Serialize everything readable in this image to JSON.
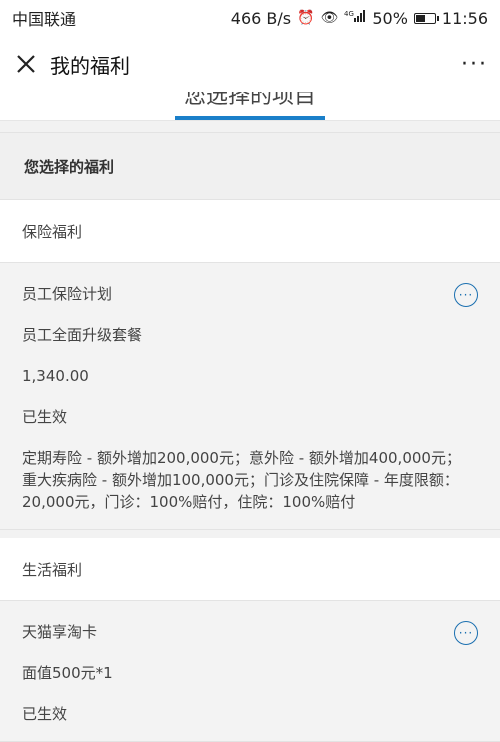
{
  "status": {
    "carrier": "中国联通",
    "speed": "466 B/s",
    "network": "4G",
    "battery": "50%",
    "time": "11:56"
  },
  "nav": {
    "title": "我的福利",
    "more_label": "···"
  },
  "tab": {
    "label": "您选择的项目"
  },
  "section": {
    "title": "您选择的福利"
  },
  "groups": [
    {
      "title": "保险福利",
      "items": [
        {
          "name": "员工保险计划",
          "plan": "员工全面升级套餐",
          "amount": "1,340.00",
          "status": "已生效",
          "description": "定期寿险 - 额外增加200,000元；意外险 - 额外增加400,000元；重大疾病险 - 额外增加100,000元；门诊及住院保障 - 年度限额：20,000元，门诊：100%赔付，住院：100%赔付"
        }
      ]
    },
    {
      "title": "生活福利",
      "items": [
        {
          "name": "天猫享淘卡",
          "plan": "面值500元*1",
          "status": "已生效"
        }
      ]
    }
  ],
  "colors": {
    "accent": "#1a7fc9",
    "icon": "#1a6fb0"
  }
}
